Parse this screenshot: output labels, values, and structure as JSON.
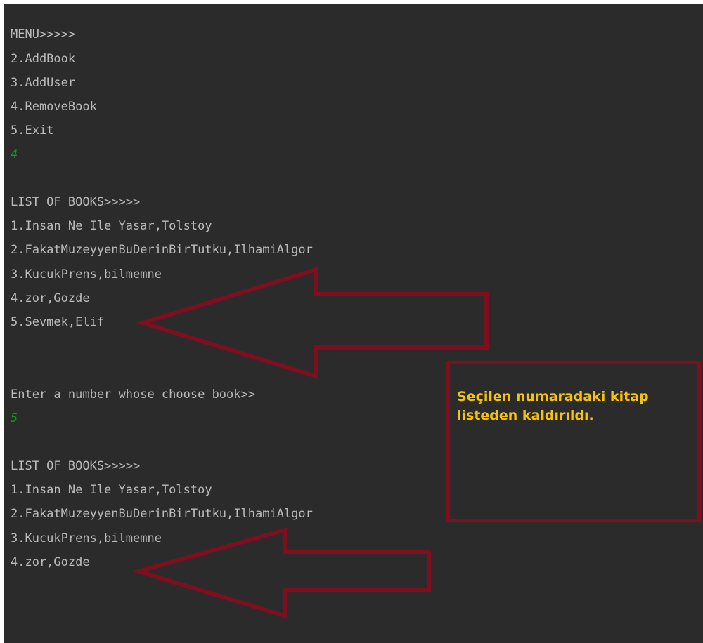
{
  "console": {
    "lines": [
      {
        "text": "MENU>>>>>",
        "kind": "output"
      },
      {
        "text": "2.AddBook",
        "kind": "output"
      },
      {
        "text": "3.AddUser",
        "kind": "output"
      },
      {
        "text": "4.RemoveBook",
        "kind": "output"
      },
      {
        "text": "5.Exit",
        "kind": "output"
      },
      {
        "text": "4",
        "kind": "input"
      },
      {
        "text": "LIST OF BOOKS>>>>>",
        "kind": "output"
      },
      {
        "text": "1.Insan Ne Ile Yasar,Tolstoy",
        "kind": "output"
      },
      {
        "text": "2.FakatMuzeyyenBuDerinBirTutku,IlhamiAlgor",
        "kind": "output"
      },
      {
        "text": "3.KucukPrens,bilmemne",
        "kind": "output"
      },
      {
        "text": "4.zor,Gozde",
        "kind": "output"
      },
      {
        "text": "5.Sevmek,Elif",
        "kind": "output"
      },
      {
        "text": "Enter a number whose choose book>>",
        "kind": "output"
      },
      {
        "text": "5",
        "kind": "input"
      },
      {
        "text": "LIST OF BOOKS>>>>>",
        "kind": "output"
      },
      {
        "text": "1.Insan Ne Ile Yasar,Tolstoy",
        "kind": "output"
      },
      {
        "text": "2.FakatMuzeyyenBuDerinBirTutku,IlhamiAlgor",
        "kind": "output"
      },
      {
        "text": "3.KucukPrens,bilmemne",
        "kind": "output"
      },
      {
        "text": "4.zor,Gozde",
        "kind": "output"
      }
    ]
  },
  "annotation": {
    "note": "Seçilen numaradaki kitap listeden kaldırıldı."
  },
  "colors": {
    "console_background": "#2b2b2b",
    "output_text": "#bbbbbb",
    "user_input_text": "#0f9d12",
    "annotation_red": "#7d0f1e",
    "annotation_text": "#f5c40a"
  }
}
